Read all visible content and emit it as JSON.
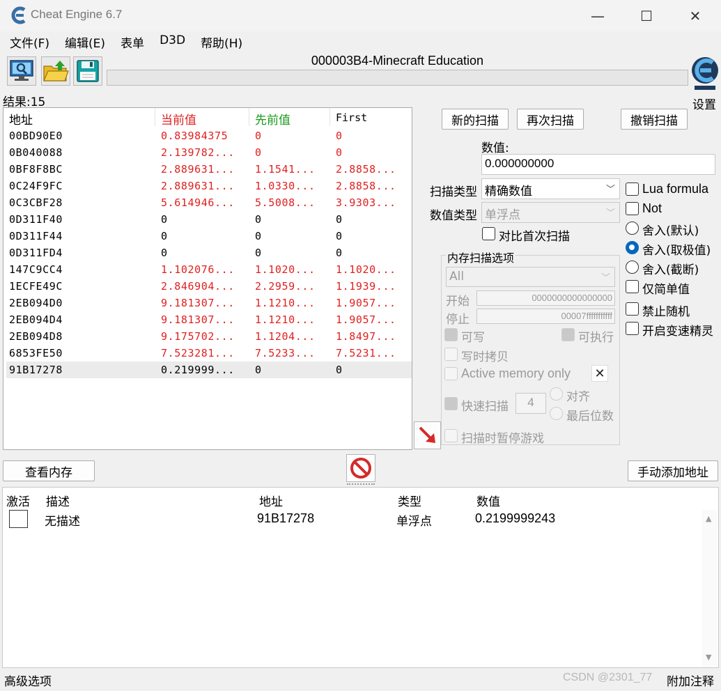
{
  "window": {
    "title": "Cheat Engine 6.7",
    "minimize": "—",
    "maximize": "☐",
    "close": "✕"
  },
  "menu": [
    "文件(F)",
    "编辑(E)",
    "表单",
    "D3D",
    "帮助(H)"
  ],
  "toolbar": {
    "process_title": "000003B4-Minecraft Education",
    "settings_label": "设置"
  },
  "results": {
    "label": "结果:15",
    "columns": [
      "地址",
      "当前值",
      "先前值",
      "First"
    ],
    "column_colors": {
      "current": "#e02020",
      "previous": "#1a9a1a"
    },
    "rows": [
      {
        "address": "00BD90E0",
        "current": "0.83984375",
        "previous": "0",
        "first": "0",
        "changed": true
      },
      {
        "address": "0B040088",
        "current": "2.139782...",
        "previous": "0",
        "first": "0",
        "changed": true
      },
      {
        "address": "0BF8F8BC",
        "current": "2.889631...",
        "previous": "1.1541...",
        "first": "2.8858...",
        "changed": true
      },
      {
        "address": "0C24F9FC",
        "current": "2.889631...",
        "previous": "1.0330...",
        "first": "2.8858...",
        "changed": true
      },
      {
        "address": "0C3CBF28",
        "current": "5.614946...",
        "previous": "5.5008...",
        "first": "3.9303...",
        "changed": true
      },
      {
        "address": "0D311F40",
        "current": "0",
        "previous": "0",
        "first": "0",
        "changed": false
      },
      {
        "address": "0D311F44",
        "current": "0",
        "previous": "0",
        "first": "0",
        "changed": false
      },
      {
        "address": "0D311FD4",
        "current": "0",
        "previous": "0",
        "first": "0",
        "changed": false
      },
      {
        "address": "147C9CC4",
        "current": "1.102076...",
        "previous": "1.1020...",
        "first": "1.1020...",
        "changed": true
      },
      {
        "address": "1ECFE49C",
        "current": "2.846904...",
        "previous": "2.2959...",
        "first": "1.1939...",
        "changed": true
      },
      {
        "address": "2EB094D0",
        "current": "9.181307...",
        "previous": "1.1210...",
        "first": "1.9057...",
        "changed": true
      },
      {
        "address": "2EB094D4",
        "current": "9.181307...",
        "previous": "1.1210...",
        "first": "1.9057...",
        "changed": true
      },
      {
        "address": "2EB094D8",
        "current": "9.175702...",
        "previous": "1.1204...",
        "first": "1.8497...",
        "changed": true
      },
      {
        "address": "6853FE50",
        "current": "7.523281...",
        "previous": "7.5233...",
        "first": "7.5231...",
        "changed": true
      },
      {
        "address": "91B17278",
        "current": "0.219999...",
        "previous": "0",
        "first": "0",
        "changed": false
      }
    ]
  },
  "scan": {
    "new_scan": "新的扫描",
    "next_scan": "再次扫描",
    "undo_scan": "撤销扫描",
    "value_label": "数值:",
    "value": "0.000000000",
    "scan_type_label": "扫描类型",
    "scan_type": "精确数值",
    "value_type_label": "数值类型",
    "value_type": "单浮点",
    "compare_first": "对比首次扫描",
    "lua_formula": "Lua formula",
    "not": "Not",
    "round_default": "舍入(默认)",
    "round_extreme": "舍入(取极值)",
    "round_truncate": "舍入(截断)",
    "simple_values": "仅简单值",
    "no_random": "禁止随机",
    "speedhack": "开启变速精灵"
  },
  "memory_options": {
    "title": "内存扫描选项",
    "region": "All",
    "start_label": "开始",
    "start": "0000000000000000",
    "stop_label": "停止",
    "stop": "00007fffffffffff",
    "writable": "可写",
    "executable": "可执行",
    "copy_on_write": "写时拷贝",
    "active_memory_only": "Active memory only",
    "fast_scan": "快速扫描",
    "fast_scan_value": "4",
    "alignment": "对齐",
    "last_digits": "最后位数",
    "pause_game": "扫描时暂停游戏"
  },
  "buttons": {
    "view_memory": "查看内存",
    "add_address": "手动添加地址"
  },
  "address_list": {
    "columns": [
      "激活",
      "描述",
      "地址",
      "类型",
      "数值"
    ],
    "rows": [
      {
        "description": "无描述",
        "address": "91B17278",
        "type": "单浮点",
        "value": "0.2199999243"
      }
    ]
  },
  "status": {
    "advanced": "高级选项",
    "annotate": "附加注释",
    "watermark": "CSDN @2301_77"
  }
}
